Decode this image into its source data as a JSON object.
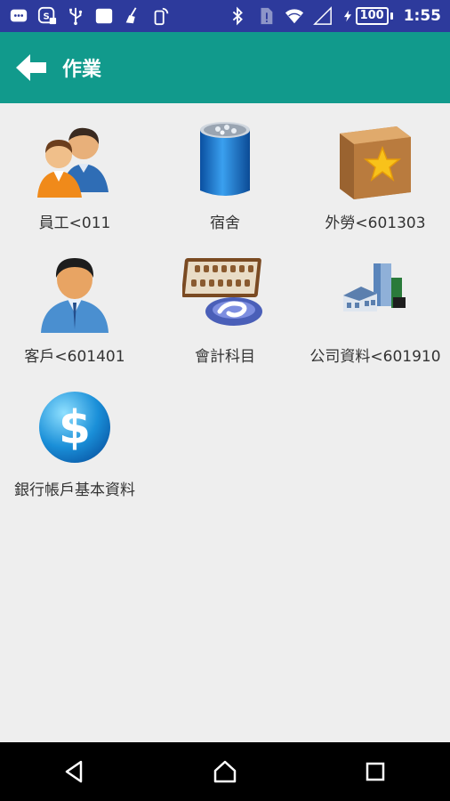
{
  "status_bar": {
    "battery": "100",
    "time": "1:55"
  },
  "app_bar": {
    "title": "作業",
    "back_icon": "arrow-left-icon"
  },
  "tiles": [
    {
      "label": "員工<011",
      "icon": "employees-icon"
    },
    {
      "label": "宿舍",
      "icon": "dormitory-icon"
    },
    {
      "label": "外勞<601303",
      "icon": "box-star-icon"
    },
    {
      "label": "客戶<601401",
      "icon": "customer-person-icon"
    },
    {
      "label": "會計科目",
      "icon": "abacus-icon"
    },
    {
      "label": "公司資料<601910",
      "icon": "buildings-icon"
    },
    {
      "label": "銀行帳戶基本資料",
      "icon": "dollar-coin-icon"
    }
  ],
  "nav_bar": {
    "back": "triangle-back-icon",
    "home": "home-icon",
    "recents": "square-recents-icon"
  }
}
